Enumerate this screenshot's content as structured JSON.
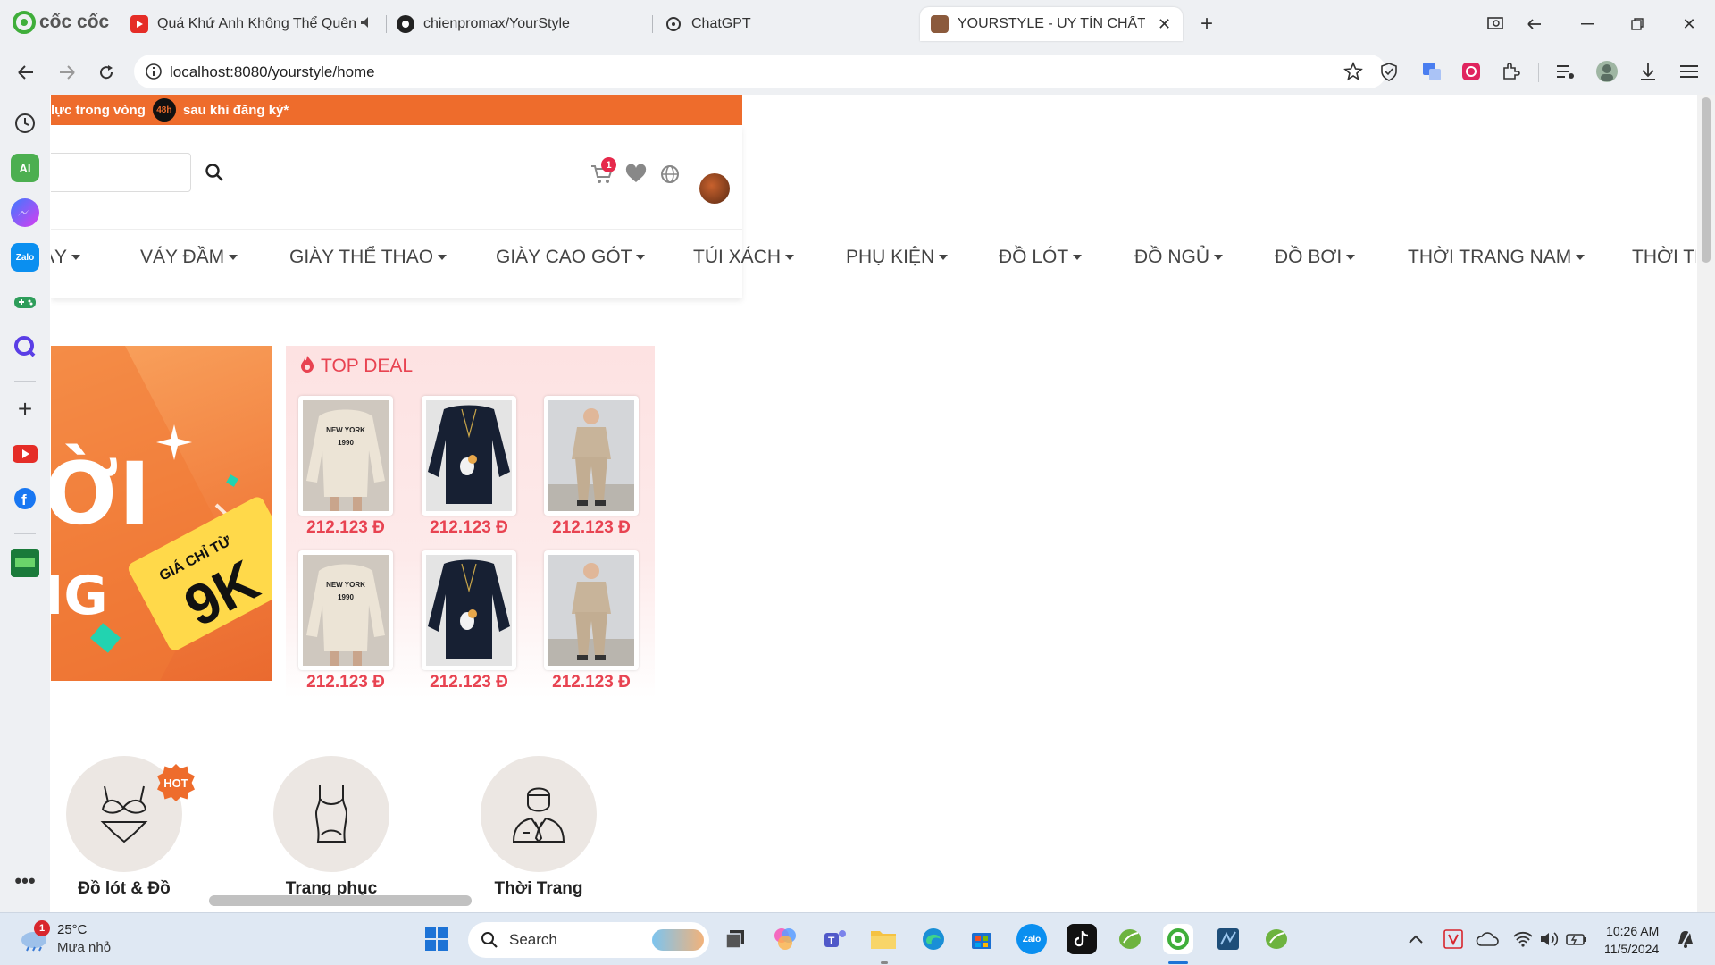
{
  "browser": {
    "brand": "cốc cốc",
    "tabs": [
      {
        "title": "Quá Khứ Anh Không Thể Quên",
        "icon": "youtube-icon"
      },
      {
        "title": "chienpromax/YourStyle",
        "icon": "github-icon"
      },
      {
        "title": "ChatGPT",
        "icon": "chatgpt-icon"
      },
      {
        "title": "YOURSTYLE - UY TÍN CHẤT LƯỢNG",
        "icon": "site-favicon",
        "active": true
      }
    ],
    "url": "localhost:8080/yourstyle/home"
  },
  "page": {
    "promo_text_left": "lực trong vòng",
    "promo_badge": "48h",
    "promo_text_right": "sau khi đăng ký*",
    "search": {
      "placeholder": "",
      "value": ""
    },
    "cart_count": "1",
    "menu": [
      "ÁY",
      "VÁY ĐẦM",
      "GIÀY THỂ THAO",
      "GIÀY CAO GÓT",
      "TÚI XÁCH",
      "PHỤ KIỆN",
      "ĐỒ LÓT",
      "ĐỒ NGỦ",
      "ĐỒ BƠI",
      "THỜI TRANG NAM",
      "THỜI TR"
    ],
    "banner": {
      "text1": "ỜI",
      "text2": "IG",
      "ticket_small": "GIÁ CHỈ TỪ",
      "ticket_big": "9K"
    },
    "top_deal": {
      "title": "TOP DEAL",
      "products": [
        {
          "image": "new-york-sweater",
          "price": "212.123 Đ"
        },
        {
          "image": "black-sweatshirt",
          "price": "212.123 Đ"
        },
        {
          "image": "kid-tracksuit",
          "price": "212.123 Đ"
        },
        {
          "image": "new-york-sweater",
          "price": "212.123 Đ"
        },
        {
          "image": "black-sweatshirt",
          "price": "212.123 Đ"
        },
        {
          "image": "kid-tracksuit",
          "price": "212.123 Đ"
        }
      ],
      "sweater_print_1": "NEW YORK",
      "sweater_print_2": "1990"
    },
    "categories": [
      {
        "label": "Đồ lót & Đồ",
        "icon": "lingerie-icon",
        "hot": "HOT"
      },
      {
        "label": "Trang phục",
        "icon": "swimsuit-icon"
      },
      {
        "label": "Thời Trang",
        "icon": "menswear-icon"
      }
    ]
  },
  "taskbar": {
    "weather_temp": "25°C",
    "weather_desc": "Mưa nhỏ",
    "weather_badge": "1",
    "search_label": "Search",
    "time": "10:26 AM",
    "date": "11/5/2024"
  },
  "colors": {
    "accent_orange": "#ee6c2c",
    "deal_red": "#e84351",
    "badge_red": "#e6294b"
  }
}
